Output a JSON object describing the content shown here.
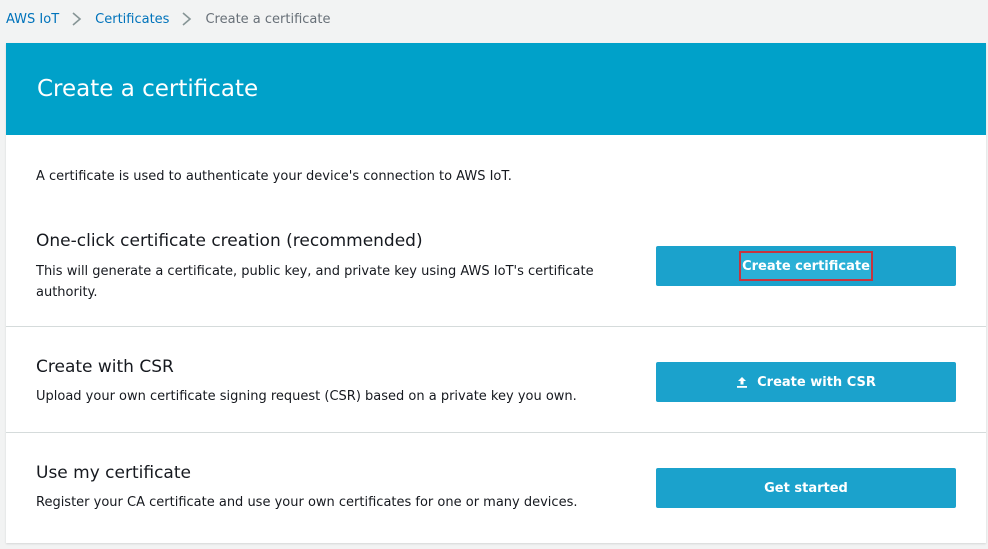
{
  "breadcrumb": {
    "items": [
      {
        "label": "AWS IoT",
        "link": true
      },
      {
        "label": "Certificates",
        "link": true
      },
      {
        "label": "Create a certificate",
        "link": false
      }
    ]
  },
  "page": {
    "title": "Create a certificate",
    "intro": "A certificate is used to authenticate your device's connection to AWS IoT."
  },
  "options": [
    {
      "title": "One-click certificate creation (recommended)",
      "description": "This will generate a certificate, public key, and private key using AWS IoT's certificate authority.",
      "button_label": "Create certificate"
    },
    {
      "title": "Create with CSR",
      "description": "Upload your own certificate signing request (CSR) based on a private key you own.",
      "button_label": "Create with CSR",
      "button_icon": "upload-icon"
    },
    {
      "title": "Use my certificate",
      "description": "Register your CA certificate and use your own certificates for one or many devices.",
      "button_label": "Get started"
    }
  ],
  "colors": {
    "header_bg": "#00a1c9",
    "button_bg": "#1ba2cc",
    "link": "#0073bb",
    "highlight_border": "#c7343e"
  }
}
